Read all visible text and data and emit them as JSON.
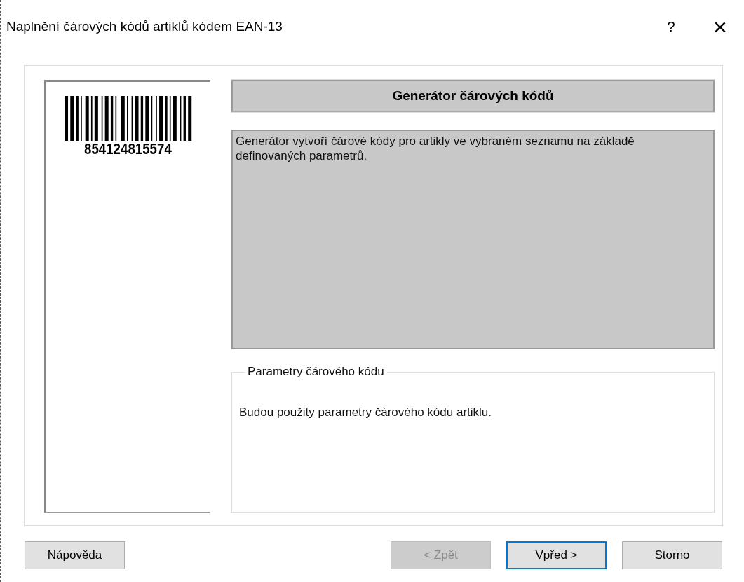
{
  "window": {
    "title": "Naplnění čárových kódů artiklů kódem EAN-13",
    "help_glyph": "?",
    "close_glyph": "×"
  },
  "barcode": {
    "number": "854124815574"
  },
  "header": "Generátor čárových kódů",
  "description": "Generátor vytvoří čárové kódy pro artikly ve vybraném seznamu na základě definovaných parametrů.",
  "group": {
    "title": "Parametry čárového kódu",
    "text": "Budou použity parametry čárového kódu artiklu."
  },
  "buttons": [
    {
      "label": "Nápověda",
      "disabled": false,
      "default": false
    },
    {
      "label": "< Zpět",
      "disabled": true,
      "default": false
    },
    {
      "label": "Vpřed >",
      "disabled": false,
      "default": true
    },
    {
      "label": "Storno",
      "disabled": false,
      "default": false
    }
  ]
}
